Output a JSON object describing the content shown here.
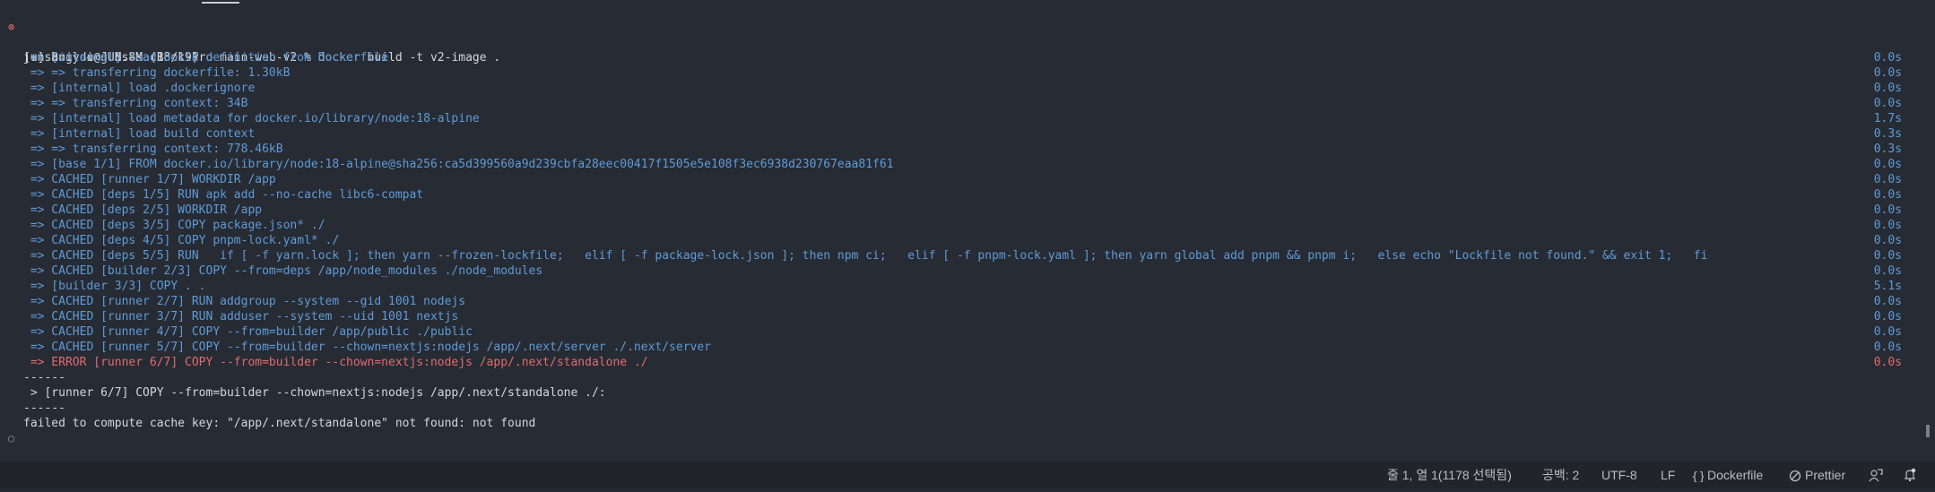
{
  "terminal": {
    "prompt_user": "junsangyoo@JUNs-MacBook-Pro main-web-v2 %",
    "command": "docker build -t v2-image .",
    "building": "[+] Building 8.8s (18/19)",
    "steps": [
      {
        "text": " => [internal] load build definition from Dockerfile",
        "time": "0.0s",
        "status": "ok"
      },
      {
        "text": " => => transferring dockerfile: 1.30kB",
        "time": "0.0s",
        "status": "ok"
      },
      {
        "text": " => [internal] load .dockerignore",
        "time": "0.0s",
        "status": "ok"
      },
      {
        "text": " => => transferring context: 34B",
        "time": "0.0s",
        "status": "ok"
      },
      {
        "text": " => [internal] load metadata for docker.io/library/node:18-alpine",
        "time": "1.7s",
        "status": "ok"
      },
      {
        "text": " => [internal] load build context",
        "time": "0.3s",
        "status": "ok"
      },
      {
        "text": " => => transferring context: 778.46kB",
        "time": "0.3s",
        "status": "ok"
      },
      {
        "text": " => [base 1/1] FROM docker.io/library/node:18-alpine@sha256:ca5d399560a9d239cbfa28eec00417f1505e5e108f3ec6938d230767eaa81f61",
        "time": "0.0s",
        "status": "ok"
      },
      {
        "text": " => CACHED [runner 1/7] WORKDIR /app",
        "time": "0.0s",
        "status": "ok"
      },
      {
        "text": " => CACHED [deps 1/5] RUN apk add --no-cache libc6-compat",
        "time": "0.0s",
        "status": "ok"
      },
      {
        "text": " => CACHED [deps 2/5] WORKDIR /app",
        "time": "0.0s",
        "status": "ok"
      },
      {
        "text": " => CACHED [deps 3/5] COPY package.json* ./",
        "time": "0.0s",
        "status": "ok"
      },
      {
        "text": " => CACHED [deps 4/5] COPY pnpm-lock.yaml* ./",
        "time": "0.0s",
        "status": "ok"
      },
      {
        "text": " => CACHED [deps 5/5] RUN   if [ -f yarn.lock ]; then yarn --frozen-lockfile;   elif [ -f package-lock.json ]; then npm ci;   elif [ -f pnpm-lock.yaml ]; then yarn global add pnpm && pnpm i;   else echo \"Lockfile not found.\" && exit 1;   fi",
        "time": "0.0s",
        "status": "ok"
      },
      {
        "text": " => CACHED [builder 2/3] COPY --from=deps /app/node_modules ./node_modules",
        "time": "0.0s",
        "status": "ok"
      },
      {
        "text": " => [builder 3/3] COPY . .",
        "time": "5.1s",
        "status": "ok"
      },
      {
        "text": " => CACHED [runner 2/7] RUN addgroup --system --gid 1001 nodejs",
        "time": "0.0s",
        "status": "ok"
      },
      {
        "text": " => CACHED [runner 3/7] RUN adduser --system --uid 1001 nextjs",
        "time": "0.0s",
        "status": "ok"
      },
      {
        "text": " => CACHED [runner 4/7] COPY --from=builder /app/public ./public",
        "time": "0.0s",
        "status": "ok"
      },
      {
        "text": " => CACHED [runner 5/7] COPY --from=builder --chown=nextjs:nodejs /app/.next/server ./.next/server",
        "time": "0.0s",
        "status": "ok"
      },
      {
        "text": " => ERROR [runner 6/7] COPY --from=builder --chown=nextjs:nodejs /app/.next/standalone ./",
        "time": "0.0s",
        "status": "error"
      }
    ],
    "separator": "------",
    "error_step": " > [runner 6/7] COPY --from=builder --chown=nextjs:nodejs /app/.next/standalone ./:",
    "error_message": "failed to compute cache key: \"/app/.next/standalone\" not found: not found"
  },
  "status_bar": {
    "position": "줄 1, 열 1(1178 선택됨)",
    "indent": "공백: 2",
    "encoding": "UTF-8",
    "eol": "LF",
    "language": "Dockerfile",
    "formatter": "Prettier"
  },
  "colors": {
    "info": "#5f9bd6",
    "error": "#e06c6c",
    "text": "#d3d6db"
  }
}
